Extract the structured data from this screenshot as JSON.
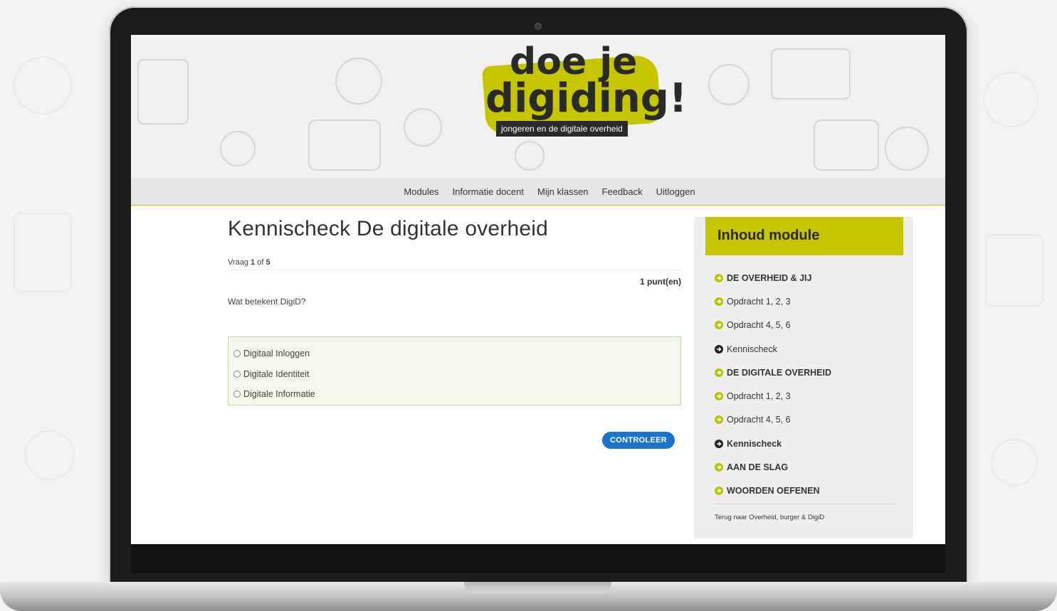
{
  "colors": {
    "brand": "#c6c500",
    "button": "#1b74c9",
    "answer_bg": "#f4f7ec"
  },
  "logo": {
    "line1": "doe je",
    "line2": "digiding!",
    "tagline": "jongeren en de digitale overheid"
  },
  "nav": {
    "items": [
      "Modules",
      "Informatie docent",
      "Mijn klassen",
      "Feedback",
      "Uitloggen"
    ]
  },
  "quiz": {
    "title": "Kennischeck De digitale overheid",
    "counter_prefix": "Vraag",
    "counter_current": "1",
    "counter_of": "of",
    "counter_total": "5",
    "points": "1 punt(en)",
    "question": "Wat betekent DigiD?",
    "answers": [
      "Digitaal Inloggen",
      "Digitale Identiteit",
      "Digitale Informatie"
    ],
    "submit_label": "CONTROLEER"
  },
  "sidebar": {
    "title": "Inhoud module",
    "items": [
      {
        "label": "DE OVERHEID & JIJ",
        "bold": true,
        "icon": "arrow-circle-icon"
      },
      {
        "label": "Opdracht 1, 2, 3",
        "bold": false,
        "icon": "arrow-circle-icon"
      },
      {
        "label": "Opdracht 4, 5, 6",
        "bold": false,
        "icon": "arrow-circle-icon"
      },
      {
        "label": "Kennischeck",
        "bold": false,
        "icon": "arrow-circle-dark-icon"
      },
      {
        "label": "DE DIGITALE OVERHEID",
        "bold": true,
        "icon": "arrow-circle-icon"
      },
      {
        "label": "Opdracht 1, 2, 3",
        "bold": false,
        "icon": "arrow-circle-icon"
      },
      {
        "label": "Opdracht 4, 5, 6",
        "bold": false,
        "icon": "arrow-circle-icon"
      },
      {
        "label": "Kennischeck",
        "bold": true,
        "icon": "arrow-circle-dark-icon"
      },
      {
        "label": "AAN DE SLAG",
        "bold": true,
        "icon": "arrow-circle-icon"
      },
      {
        "label": "WOORDEN OEFENEN",
        "bold": true,
        "icon": "arrow-circle-icon"
      }
    ],
    "back_link": "Terug naar Overheid, burger & DigiD"
  }
}
